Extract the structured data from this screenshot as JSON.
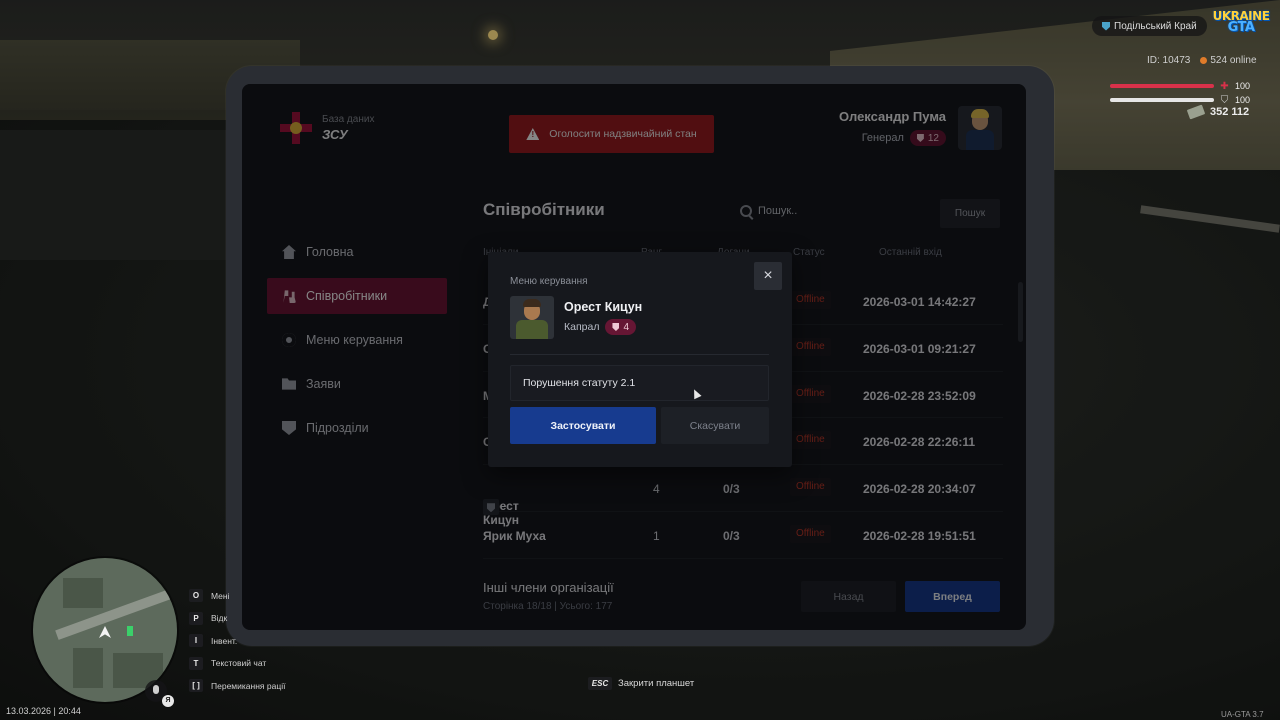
{
  "hud": {
    "region": "Подільський Край",
    "logo_top": "UKRAINE",
    "logo_bottom": "GTA",
    "player_id": "ID: 10473",
    "online": "524 online",
    "health": "100",
    "health_fraction": 1.0,
    "armor": "100",
    "armor_fraction": 1.0,
    "money": "352 112",
    "date_time": "13.03.2026 | 20:44",
    "version": "UA-GTA 3.7",
    "lang_badge": "Я",
    "esc_hint": {
      "key": "ESC",
      "label": "Закрити планшет"
    },
    "keybinds": [
      {
        "key": "O",
        "label": "Мені"
      },
      {
        "key": "P",
        "label": "Відк"
      },
      {
        "key": "I",
        "label": "Інвент."
      },
      {
        "key": "T",
        "label": "Текстовий чат"
      },
      {
        "key": "[ ]",
        "label": "Перемикання рації"
      }
    ]
  },
  "tablet": {
    "brand": {
      "subtitle": "База даних",
      "name": "ЗСУ"
    },
    "emergency_button": "Оголосити надзвичайний стан",
    "user": {
      "name": "Олександр Пума",
      "rank": "Генерал",
      "rank_level": "12"
    },
    "nav": [
      {
        "label": "Головна",
        "icon": "home-icon",
        "active": false
      },
      {
        "label": "Співробітники",
        "icon": "users-icon",
        "active": true
      },
      {
        "label": "Меню керування",
        "icon": "gear-icon",
        "active": false
      },
      {
        "label": "Заяви",
        "icon": "folder-icon",
        "active": false
      },
      {
        "label": "Підрозділи",
        "icon": "shield-icon",
        "active": false
      }
    ],
    "section_title": "Співробітники",
    "search": {
      "placeholder": "Пошук..",
      "button": "Пошук"
    },
    "table": {
      "headers": [
        "Ініціали",
        "Ранг",
        "Догани",
        "Статус",
        "Останній вхід"
      ],
      "rows": [
        {
          "name": "Д",
          "rank": "",
          "warns": "",
          "status": "Offline",
          "last_login": "2026-03-01 14:42:27"
        },
        {
          "name": "С",
          "rank": "",
          "warns": "",
          "status": "Offline",
          "last_login": "2026-03-01 09:21:27"
        },
        {
          "name": "М",
          "rank": "",
          "warns": "",
          "status": "Offline",
          "last_login": "2026-02-28 23:52:09"
        },
        {
          "name": "С",
          "rank": "",
          "warns": "",
          "status": "Offline",
          "last_login": "2026-02-28 22:26:11"
        },
        {
          "name": "Орест Кицун",
          "rank": "4",
          "warns": "0/3",
          "status": "Offline",
          "last_login": "2026-02-28 20:34:07"
        },
        {
          "name": "Ярик Муха",
          "rank": "1",
          "warns": "0/3",
          "status": "Offline",
          "last_login": "2026-02-28 19:51:51"
        }
      ]
    },
    "footer": {
      "title": "Інші члени організації",
      "pagination": "Сторінка 18/18 | Усього: 177",
      "back": "Назад",
      "next": "Вперед"
    }
  },
  "modal": {
    "title": "Меню керування",
    "close": "×",
    "employee": {
      "name": "Орест Кицун",
      "rank": "Капрал",
      "rank_level": "4"
    },
    "reason_value": "Порушення статуту 2.1",
    "apply": "Застосувати",
    "cancel": "Скасувати"
  },
  "colors": {
    "accent_crimson": "#6e1636",
    "primary_blue": "#173b8f",
    "danger_red": "#9b1c22",
    "offline_red": "#c0392b",
    "health_red": "#d8314a",
    "armor_white": "#e6e6e6"
  }
}
